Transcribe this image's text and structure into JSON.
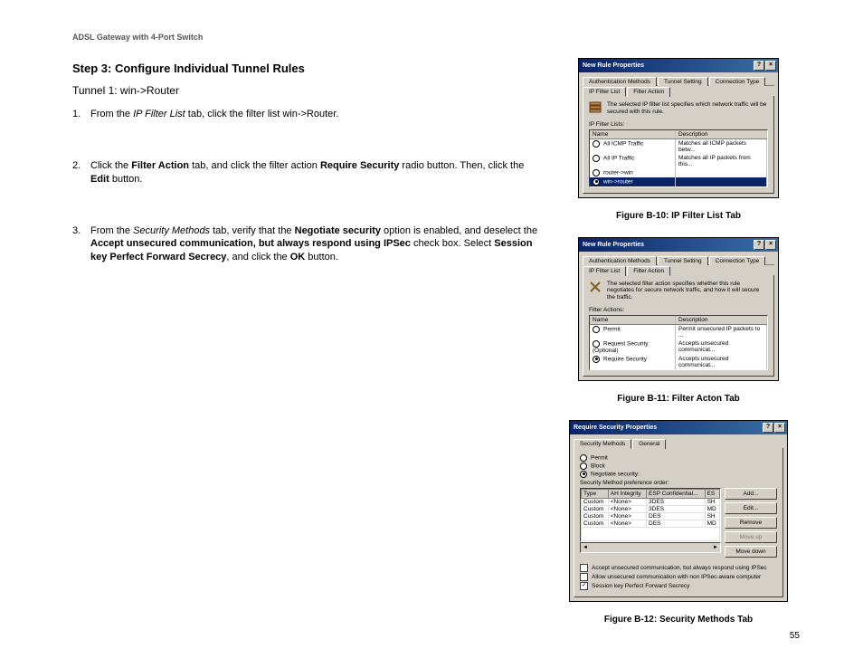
{
  "header": "ADSL Gateway with 4-Port Switch",
  "step_title": "Step 3: Configure Individual Tunnel Rules",
  "tunnel_title": "Tunnel 1: win->Router",
  "page_number": "55",
  "steps": {
    "s1": {
      "pre": "From the ",
      "italic": "IP Filter List",
      "post": " tab, click the filter list win->Router."
    },
    "s2": {
      "t1": "Click the ",
      "b1": "Filter Action",
      "t2": " tab, and click the filter action ",
      "b2": "Require Security",
      "t3": " radio button. Then, click the ",
      "b3": "Edit",
      "t4": " button."
    },
    "s3": {
      "t1": "From the ",
      "i1": "Security Methods",
      "t2": " tab, verify that the ",
      "b1": "Negotiate security",
      "t3": " option is enabled, and deselect the ",
      "b2": "Accept unsecured communication, but always respond using IPSec",
      "t4": " check box. Select ",
      "b3": "Session key Perfect Forward Secrecy",
      "t5": ", and click the ",
      "b4": "OK",
      "t6": " button."
    }
  },
  "fig10": {
    "caption": "Figure B-10: IP Filter List Tab",
    "title": "New Rule Properties",
    "tabs": {
      "row1": [
        "Authentication Methods",
        "Tunnel Setting",
        "Connection Type"
      ],
      "row2": [
        "IP Filter List",
        "Filter Action"
      ]
    },
    "info": "The selected IP filter list specifies which network traffic will be secured with this rule.",
    "group": "IP Filter Lists:",
    "cols": [
      "Name",
      "Description"
    ],
    "rows": [
      {
        "name": "All ICMP Traffic",
        "desc": "Matches all ICMP packets betw...",
        "on": false
      },
      {
        "name": "All IP Traffic",
        "desc": "Matches all IP packets from this...",
        "on": false
      },
      {
        "name": "router->win",
        "desc": "",
        "on": false
      },
      {
        "name": "win->router",
        "desc": "",
        "on": true,
        "sel": true
      }
    ]
  },
  "fig11": {
    "caption": "Figure B-11: Filter Acton Tab",
    "title": "New Rule Properties",
    "tabs": {
      "row1": [
        "Authentication Methods",
        "Tunnel Setting",
        "Connection Type"
      ],
      "row2": [
        "IP Filter List",
        "Filter Action"
      ]
    },
    "info": "The selected filter action specifies whether this rule negotiates for secure network traffic, and how it will secure the traffic.",
    "group": "Filter Actions:",
    "cols": [
      "Name",
      "Description"
    ],
    "rows": [
      {
        "name": "Permit",
        "desc": "Permit unsecured IP packets to ...",
        "on": false
      },
      {
        "name": "Request Security (Optional)",
        "desc": "Accepts unsecured communicat...",
        "on": false
      },
      {
        "name": "Require Security",
        "desc": "Accepts unsecured communicat...",
        "on": true
      }
    ]
  },
  "fig12": {
    "caption": "Figure B-12: Security Methods Tab",
    "title": "Require Security Properties",
    "tabs": [
      "Security Methods",
      "General"
    ],
    "radios": [
      {
        "label": "Permit",
        "on": false
      },
      {
        "label": "Block",
        "on": false
      },
      {
        "label": "Negotiate security:",
        "on": true
      }
    ],
    "pref_label": "Security Method preference order:",
    "cols": [
      "Type",
      "AH Integrity",
      "ESP Confidential...",
      "ES"
    ],
    "rows": [
      [
        "Custom",
        "<None>",
        "3DES",
        "SH"
      ],
      [
        "Custom",
        "<None>",
        "3DES",
        "MD"
      ],
      [
        "Custom",
        "<None>",
        "DES",
        "SH"
      ],
      [
        "Custom",
        "<None>",
        "DES",
        "MD"
      ]
    ],
    "buttons": {
      "add": "Add...",
      "edit": "Edit...",
      "remove": "Remove",
      "up": "Move up",
      "down": "Move down"
    },
    "checks": [
      {
        "label": "Accept unsecured communication, but always respond using IPSec",
        "on": false
      },
      {
        "label": "Allow unsecured communication with non IPSec-aware computer",
        "on": false
      },
      {
        "label": "Session key Perfect Forward Secrecy",
        "on": true
      }
    ]
  }
}
